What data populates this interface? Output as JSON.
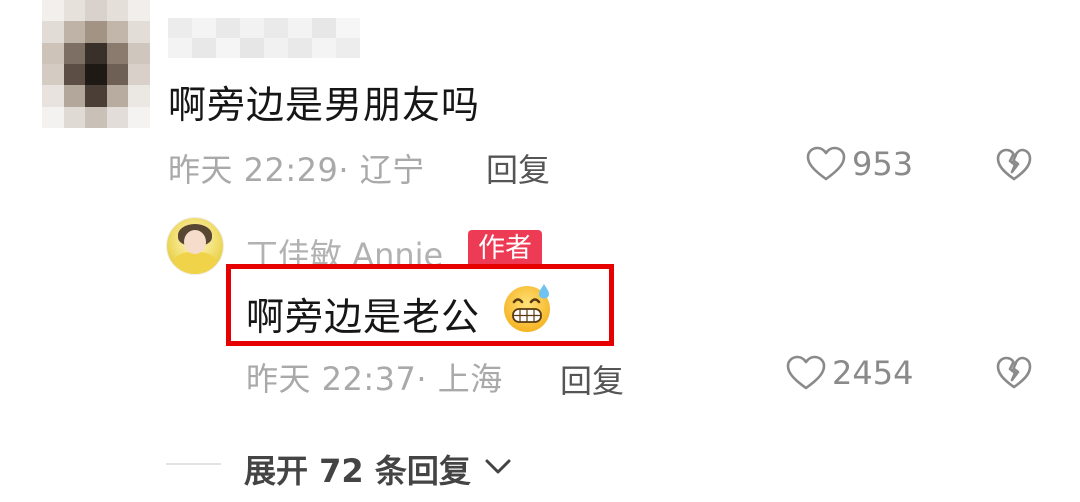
{
  "comment": {
    "text": "啊旁边是男朋友吗",
    "meta": "昨天 22:29· 辽宁",
    "reply_label": "回复",
    "like_count": "953"
  },
  "reply": {
    "author_name": "丁佳敏 Annie",
    "author_badge": "作者",
    "text": "啊旁边是老公",
    "meta": "昨天 22:37· 上海",
    "reply_label": "回复",
    "like_count": "2454"
  },
  "expand": {
    "label": "展开 72 条回复"
  },
  "colors": {
    "badge": "#ee3b55",
    "highlight_box": "#e60000",
    "meta_text": "#a9a9a9",
    "icon_gray": "#8a8a8a"
  },
  "icons": [
    "heart-outline-icon",
    "broken-heart-icon",
    "grinning-sweat-emoji-icon",
    "chevron-down-icon"
  ]
}
